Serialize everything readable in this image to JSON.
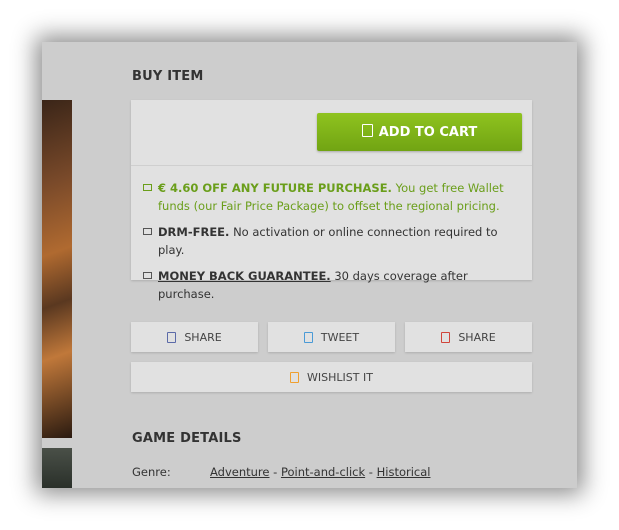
{
  "buy_section": {
    "title": "BUY ITEM",
    "add_to_cart_label": "ADD TO CART",
    "features": [
      {
        "bold": "€ 4.60 OFF ANY FUTURE PURCHASE.",
        "text": " You get free Wallet funds (our Fair Price Package) to offset the regional pricing."
      },
      {
        "bold": "DRM-FREE.",
        "text": " No activation or online connection required to play."
      },
      {
        "bold": "MONEY BACK GUARANTEE.",
        "text": " 30 days coverage after purchase."
      }
    ],
    "accent_color": "#7cb518"
  },
  "social": {
    "facebook_label": "SHARE",
    "twitter_label": "TWEET",
    "google_label": "SHARE",
    "wishlist_label": "WISHLIST IT",
    "icon_colors": {
      "facebook": "#5b6aa8",
      "twitter": "#4a9ad6",
      "google": "#d0443a",
      "wishlist": "#f0a030"
    }
  },
  "game_details": {
    "title": "GAME DETAILS",
    "genre_label": "Genre:",
    "genres": [
      "Adventure",
      "Point-and-click",
      "Historical"
    ],
    "separator": " - "
  }
}
